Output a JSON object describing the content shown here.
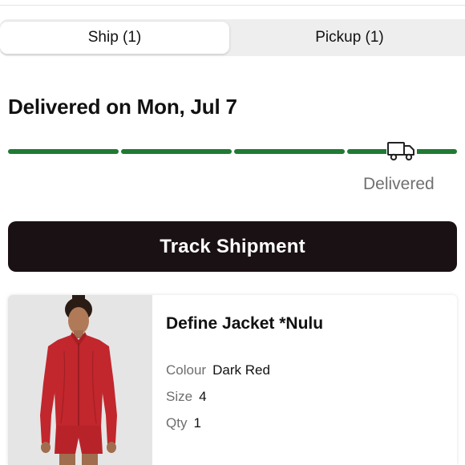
{
  "tabs": [
    {
      "label": "Ship (1)",
      "selected": true
    },
    {
      "label": "Pickup (1)",
      "selected": false
    }
  ],
  "delivery": {
    "heading": "Delivered on Mon, Jul 7",
    "status": "Delivered",
    "progress_steps_total": 4,
    "progress_steps_complete": 4,
    "icon": "truck-icon"
  },
  "track_button": {
    "label": "Track Shipment"
  },
  "product": {
    "name": "Define Jacket *Nulu",
    "colour_label": "Colour",
    "colour_value": "Dark Red",
    "size_label": "Size",
    "size_value": "4",
    "qty_label": "Qty",
    "qty_value": "1",
    "image": "product-photo"
  },
  "colors": {
    "progress": "#1f7a33",
    "button": "#1a1114",
    "product": "#c1272d"
  }
}
